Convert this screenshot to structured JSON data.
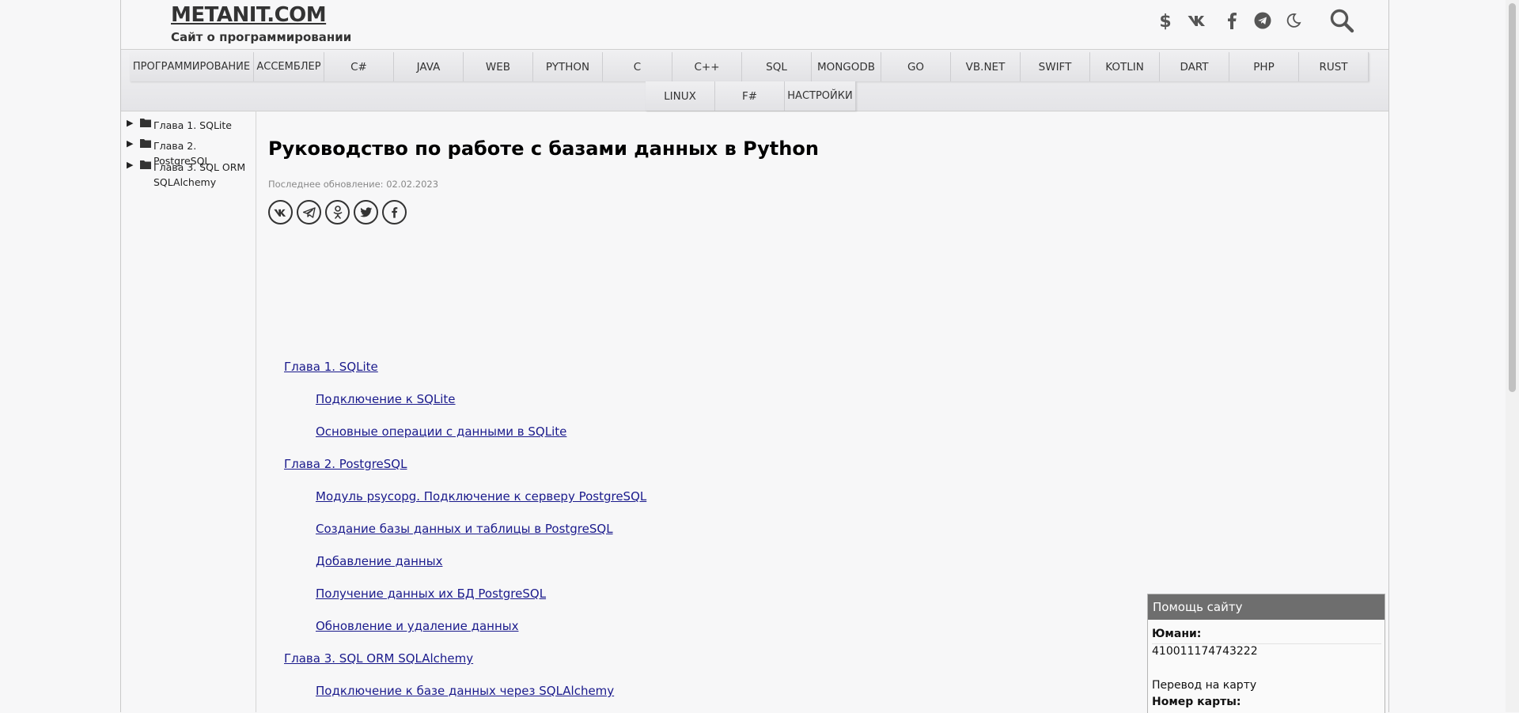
{
  "header": {
    "logo": "METANIT.COM",
    "tagline": "Сайт о программировании",
    "icons": [
      "dollar-icon",
      "vk-icon",
      "facebook-icon",
      "telegram-icon",
      "moon-icon",
      "search-icon"
    ]
  },
  "nav": {
    "row1": [
      "ПРОГРАММИРОВАНИЕ",
      "АССЕМБЛЕР",
      "C#",
      "JAVA",
      "WEB",
      "PYTHON",
      "C",
      "C++",
      "SQL",
      "MONGODB",
      "GO",
      "VB.NET",
      "SWIFT",
      "KOTLIN",
      "DART",
      "PHP",
      "RUST"
    ],
    "row2": [
      "LINUX",
      "F#",
      "НАСТРОЙКИ"
    ]
  },
  "sidebar": {
    "items": [
      {
        "label": "Глава 1. SQLite"
      },
      {
        "label": "Глава 2. PostgreSQL"
      },
      {
        "label": "Глава 3. SQL ORM SQLAlchemy"
      }
    ]
  },
  "main": {
    "title": "Руководство по работе с базами данных в Python",
    "updated": "Последнее обновление: 02.02.2023",
    "share": [
      "vk-icon",
      "telegram-icon",
      "odnoklassniki-icon",
      "twitter-icon",
      "facebook-icon"
    ],
    "toc": [
      {
        "label": "Глава 1. SQLite",
        "level": 1
      },
      {
        "label": "Подключение к SQLite",
        "level": 2
      },
      {
        "label": "Основные операции с данными в SQLite",
        "level": 2
      },
      {
        "label": "Глава 2. PostgreSQL",
        "level": 1
      },
      {
        "label": "Модуль psycopg. Подключение к серверу PostgreSQL",
        "level": 2
      },
      {
        "label": "Создание базы данных и таблицы в PostgreSQL",
        "level": 2
      },
      {
        "label": "Добавление данных",
        "level": 2
      },
      {
        "label": "Получение данных их БД PostgreSQL",
        "level": 2
      },
      {
        "label": "Обновление и удаление данных",
        "level": 2
      },
      {
        "label": "Глава 3. SQL ORM SQLAlchemy",
        "level": 1
      },
      {
        "label": "Подключение к базе данных через SQLAlchemy",
        "level": 2
      }
    ]
  },
  "help": {
    "title": "Помощь сайту",
    "yumoney_label": "Юмани:",
    "yumoney_value": "410011174743222",
    "card_transfer": "Перевод на карту",
    "card_number_label": "Номер карты:"
  },
  "colors": {
    "link": "#1a1a8c",
    "help_header": "#6e6e6e"
  }
}
